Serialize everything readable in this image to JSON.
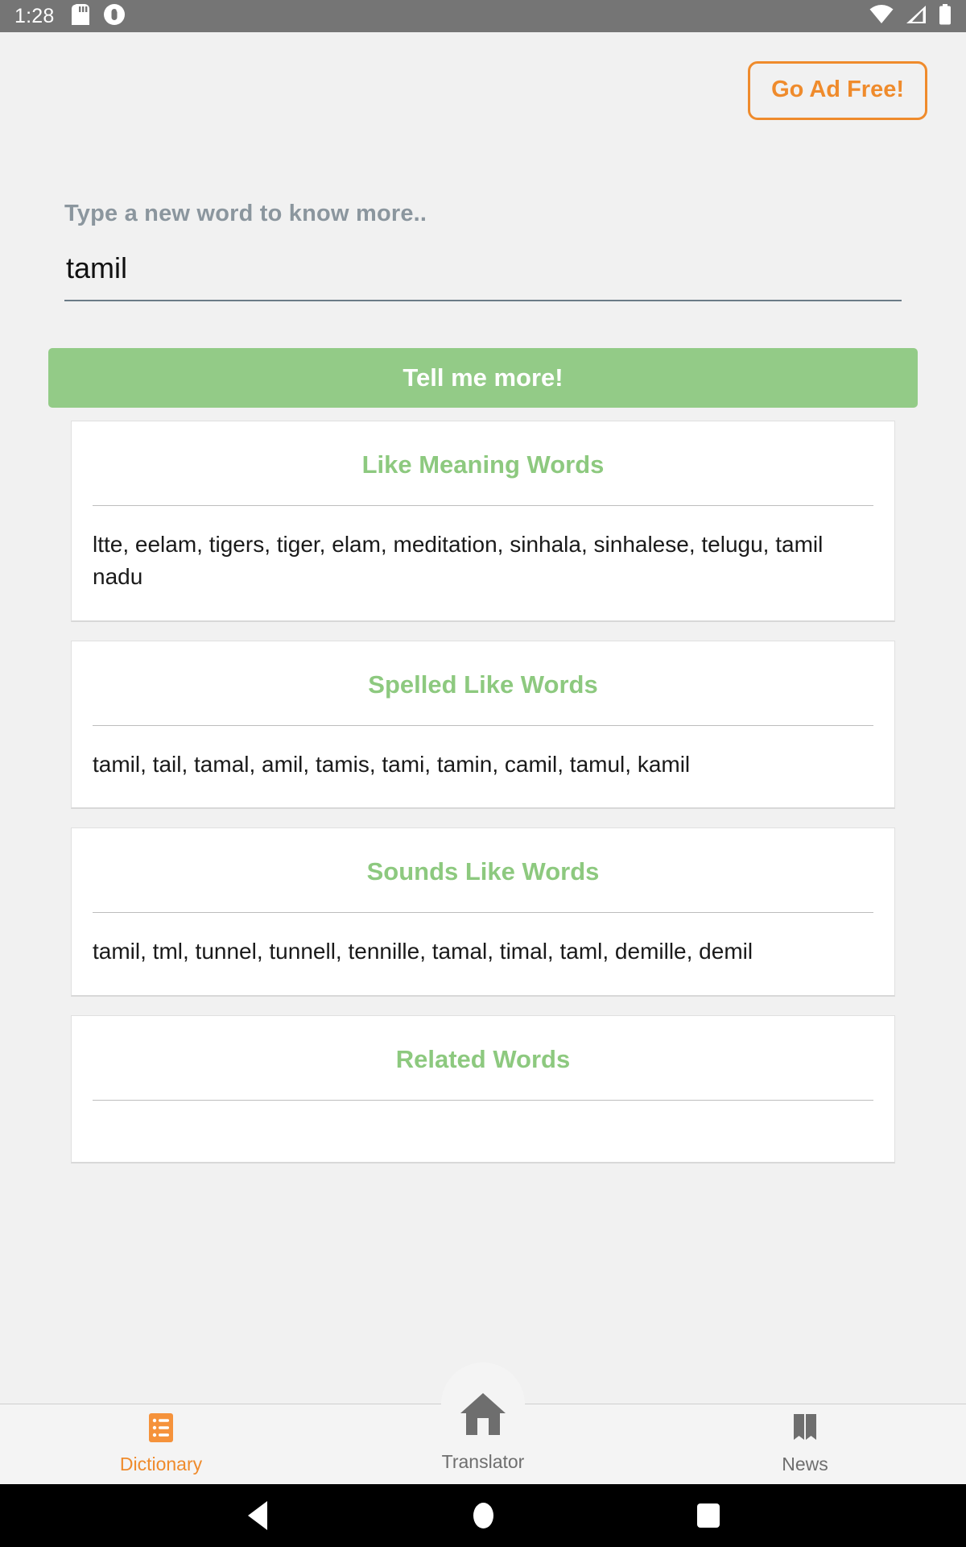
{
  "statusbar": {
    "clock": "1:28",
    "icons_left": [
      "sd-card-icon",
      "app-notification-icon"
    ],
    "icons_right": [
      "wifi-icon",
      "cellular-signal-icon",
      "battery-icon"
    ],
    "background_color": "#757575"
  },
  "header": {
    "go_ad_free_label": "Go Ad Free!",
    "accent_color": "#ef8b2c"
  },
  "search": {
    "label": "Type a new word to know more..",
    "value": "tamil",
    "placeholder": "Type a new word to know more.."
  },
  "primary_action": {
    "label": "Tell me more!",
    "color": "#93cb87"
  },
  "cards": [
    {
      "title": "Like Meaning Words",
      "body": "ltte, eelam, tigers, tiger, elam, meditation, sinhala, sinhalese, telugu, tamil nadu"
    },
    {
      "title": "Spelled Like Words",
      "body": "tamil, tail, tamal, amil, tamis, tami, tamin, camil, tamul, kamil"
    },
    {
      "title": "Sounds Like Words",
      "body": "tamil, tml, tunnel, tunnell, tennille, tamal, timal, taml, demille, demil"
    },
    {
      "title": "Related Words",
      "body": ""
    }
  ],
  "bottom_nav": {
    "items": [
      {
        "label": "Dictionary",
        "icon": "list-icon",
        "active": true
      },
      {
        "label": "Translator",
        "icon": "home-icon",
        "active": false
      },
      {
        "label": "News",
        "icon": "book-icon",
        "active": false
      }
    ],
    "active_color": "#ef8b2c",
    "inactive_color": "#6e6e6e"
  },
  "android_nav": {
    "back": "back-triangle-icon",
    "home": "home-circle-icon",
    "recents": "recents-square-icon"
  }
}
